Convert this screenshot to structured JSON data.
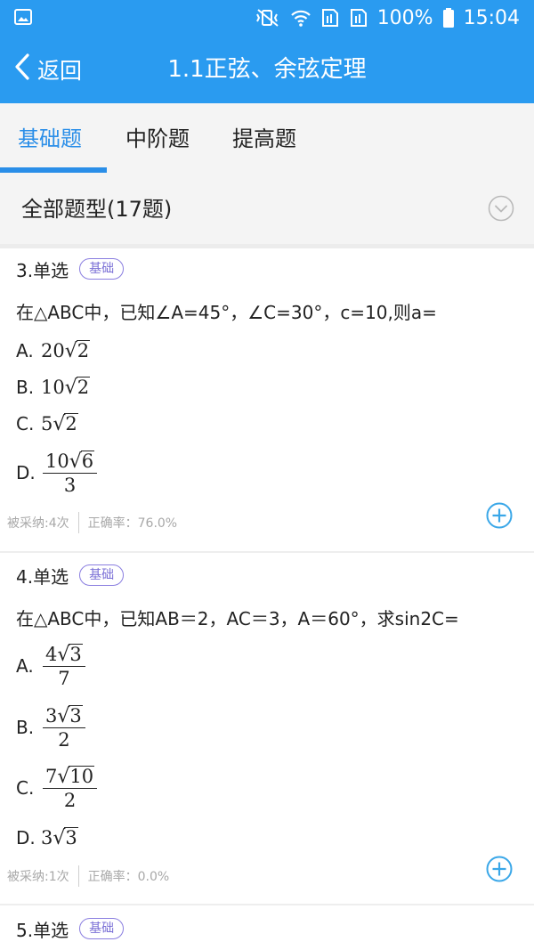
{
  "status_bar": {
    "battery": "100%",
    "time": "15:04",
    "icons": [
      "image-icon",
      "mute-vibrate-icon",
      "wifi-icon",
      "sim1-icon",
      "sim2-icon",
      "battery-icon"
    ]
  },
  "header": {
    "back_label": "返回",
    "title": "1.1正弦、余弦定理"
  },
  "tabs": [
    {
      "label": "基础题",
      "active": true
    },
    {
      "label": "中阶题",
      "active": false
    },
    {
      "label": "提高题",
      "active": false
    }
  ],
  "filter": {
    "label": "全部题型(17题)"
  },
  "colors": {
    "primary": "#2a9bf0",
    "tab_active": "#2a8ee8",
    "badge": "#7a6fd6",
    "add_button": "#3aa7e8"
  },
  "questions": [
    {
      "type": "3.单选",
      "badge": "基础",
      "stem": "在△ABC中，已知∠A=45°，∠C=30°，c=10,则a=",
      "options": {
        "a": {
          "letter": "A.",
          "coef": "20",
          "radicand": "2"
        },
        "b": {
          "letter": "B.",
          "coef": "10",
          "radicand": "2"
        },
        "c": {
          "letter": "C.",
          "coef": "5",
          "radicand": "2"
        },
        "d": {
          "letter": "D.",
          "coef": "10",
          "radicand": "6",
          "den": "3"
        }
      },
      "adopted": "被采纳:4次",
      "accuracy": "正确率：76.0%"
    },
    {
      "type": "4.单选",
      "badge": "基础",
      "stem": "在△ABC中，已知AB＝2，AC＝3，A＝60°，求sin2C=",
      "options": {
        "a": {
          "letter": "A.",
          "coef": "4",
          "radicand": "3",
          "den": "7"
        },
        "b": {
          "letter": "B.",
          "coef": "3",
          "radicand": "3",
          "den": "2"
        },
        "c": {
          "letter": "C.",
          "coef": "7",
          "radicand": "10",
          "den": "2"
        },
        "d": {
          "letter": "D.",
          "coef": "3",
          "radicand": "3"
        }
      },
      "adopted": "被采纳:1次",
      "accuracy": "正确率：0.0%"
    },
    {
      "type": "5.单选",
      "badge": "基础"
    }
  ]
}
